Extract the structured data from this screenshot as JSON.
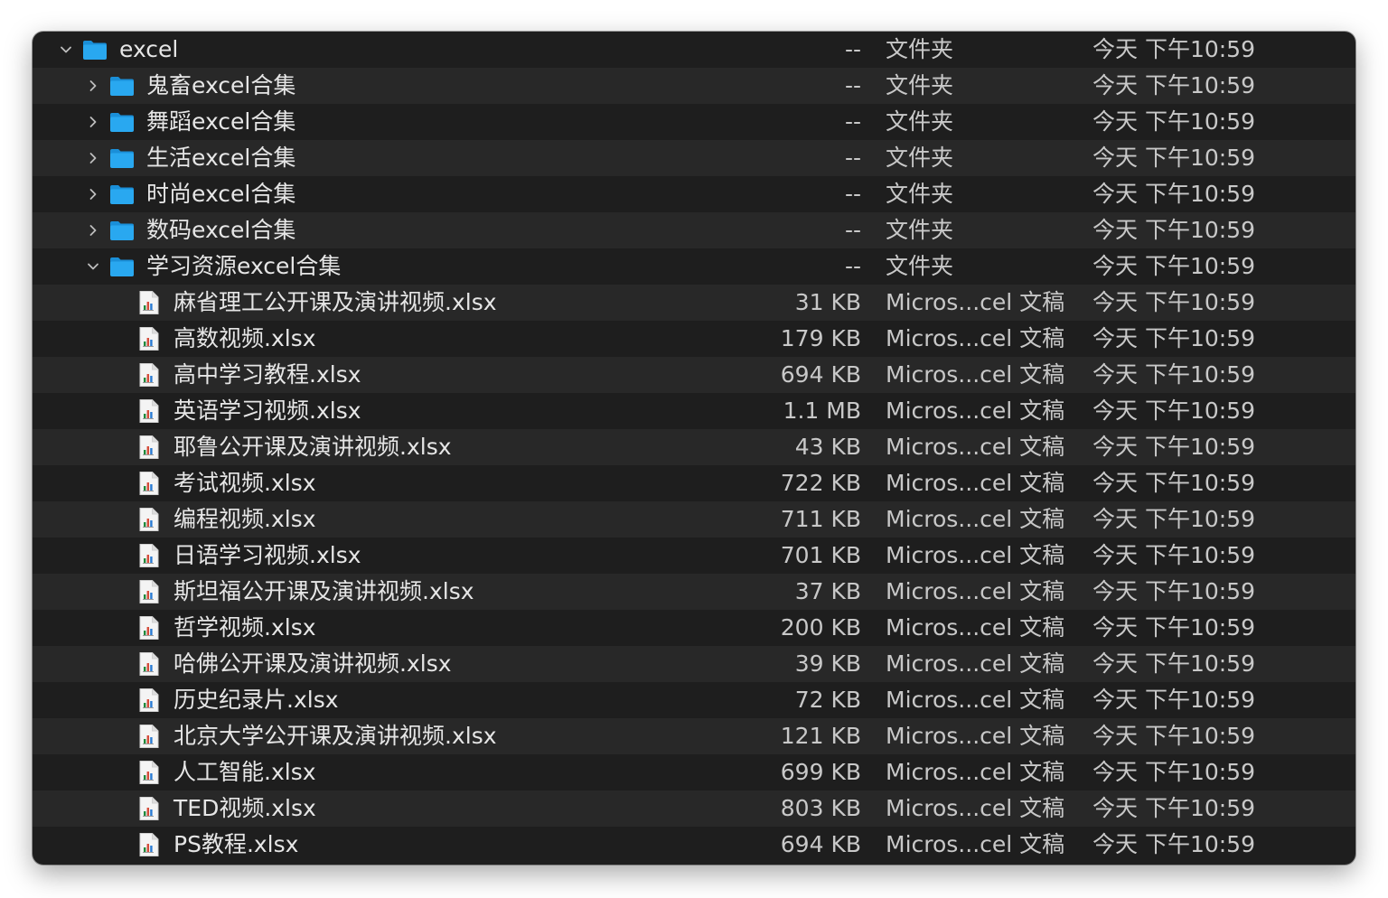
{
  "rows": [
    {
      "name": "excel",
      "size": "--",
      "kind": "文件夹",
      "date": "今天 下午10:59",
      "type": "folder",
      "level": 0,
      "expanded": true
    },
    {
      "name": "鬼畜excel合集",
      "size": "--",
      "kind": "文件夹",
      "date": "今天 下午10:59",
      "type": "folder",
      "level": 1,
      "expanded": false
    },
    {
      "name": "舞蹈excel合集",
      "size": "--",
      "kind": "文件夹",
      "date": "今天 下午10:59",
      "type": "folder",
      "level": 1,
      "expanded": false
    },
    {
      "name": "生活excel合集",
      "size": "--",
      "kind": "文件夹",
      "date": "今天 下午10:59",
      "type": "folder",
      "level": 1,
      "expanded": false
    },
    {
      "name": "时尚excel合集",
      "size": "--",
      "kind": "文件夹",
      "date": "今天 下午10:59",
      "type": "folder",
      "level": 1,
      "expanded": false
    },
    {
      "name": "数码excel合集",
      "size": "--",
      "kind": "文件夹",
      "date": "今天 下午10:59",
      "type": "folder",
      "level": 1,
      "expanded": false
    },
    {
      "name": "学习资源excel合集",
      "size": "--",
      "kind": "文件夹",
      "date": "今天 下午10:59",
      "type": "folder",
      "level": 1,
      "expanded": true
    },
    {
      "name": "麻省理工公开课及演讲视频.xlsx",
      "size": "31 KB",
      "kind": "Micros...cel 文稿",
      "date": "今天 下午10:59",
      "type": "xlsx",
      "level": 2
    },
    {
      "name": "高数视频.xlsx",
      "size": "179 KB",
      "kind": "Micros...cel 文稿",
      "date": "今天 下午10:59",
      "type": "xlsx",
      "level": 2
    },
    {
      "name": "高中学习教程.xlsx",
      "size": "694 KB",
      "kind": "Micros...cel 文稿",
      "date": "今天 下午10:59",
      "type": "xlsx",
      "level": 2
    },
    {
      "name": "英语学习视频.xlsx",
      "size": "1.1 MB",
      "kind": "Micros...cel 文稿",
      "date": "今天 下午10:59",
      "type": "xlsx",
      "level": 2
    },
    {
      "name": "耶鲁公开课及演讲视频.xlsx",
      "size": "43 KB",
      "kind": "Micros...cel 文稿",
      "date": "今天 下午10:59",
      "type": "xlsx",
      "level": 2
    },
    {
      "name": "考试视频.xlsx",
      "size": "722 KB",
      "kind": "Micros...cel 文稿",
      "date": "今天 下午10:59",
      "type": "xlsx",
      "level": 2
    },
    {
      "name": "编程视频.xlsx",
      "size": "711 KB",
      "kind": "Micros...cel 文稿",
      "date": "今天 下午10:59",
      "type": "xlsx",
      "level": 2
    },
    {
      "name": "日语学习视频.xlsx",
      "size": "701 KB",
      "kind": "Micros...cel 文稿",
      "date": "今天 下午10:59",
      "type": "xlsx",
      "level": 2
    },
    {
      "name": "斯坦福公开课及演讲视频.xlsx",
      "size": "37 KB",
      "kind": "Micros...cel 文稿",
      "date": "今天 下午10:59",
      "type": "xlsx",
      "level": 2
    },
    {
      "name": "哲学视频.xlsx",
      "size": "200 KB",
      "kind": "Micros...cel 文稿",
      "date": "今天 下午10:59",
      "type": "xlsx",
      "level": 2
    },
    {
      "name": "哈佛公开课及演讲视频.xlsx",
      "size": "39 KB",
      "kind": "Micros...cel 文稿",
      "date": "今天 下午10:59",
      "type": "xlsx",
      "level": 2
    },
    {
      "name": "历史纪录片.xlsx",
      "size": "72 KB",
      "kind": "Micros...cel 文稿",
      "date": "今天 下午10:59",
      "type": "xlsx",
      "level": 2
    },
    {
      "name": "北京大学公开课及演讲视频.xlsx",
      "size": "121 KB",
      "kind": "Micros...cel 文稿",
      "date": "今天 下午10:59",
      "type": "xlsx",
      "level": 2
    },
    {
      "name": "人工智能.xlsx",
      "size": "699 KB",
      "kind": "Micros...cel 文稿",
      "date": "今天 下午10:59",
      "type": "xlsx",
      "level": 2
    },
    {
      "name": "TED视频.xlsx",
      "size": "803 KB",
      "kind": "Micros...cel 文稿",
      "date": "今天 下午10:59",
      "type": "xlsx",
      "level": 2
    },
    {
      "name": "PS教程.xlsx",
      "size": "694 KB",
      "kind": "Micros...cel 文稿",
      "date": "今天 下午10:59",
      "type": "xlsx",
      "level": 2
    }
  ],
  "colors": {
    "folder": "#29a8f0",
    "folder_tab": "#1a8fd8",
    "row_alt": "#282828",
    "background": "#1e1e1e"
  },
  "icons": {
    "folder": "folder-icon",
    "xlsx": "xlsx-file-icon",
    "expanded": "chevron-down-icon",
    "collapsed": "chevron-right-icon"
  }
}
